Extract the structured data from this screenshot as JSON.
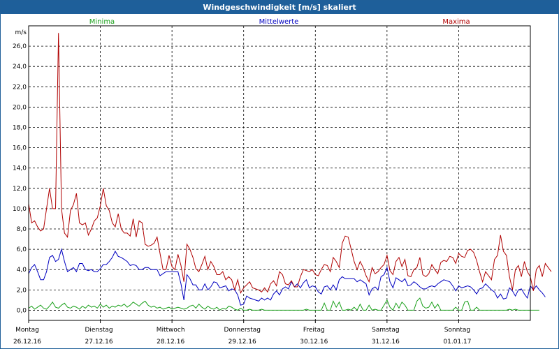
{
  "window": {
    "title": "Windgeschwindigkeit [m/s] skaliert"
  },
  "chart_data": {
    "type": "line",
    "title": "Windgeschwindigkeit [m/s] skaliert",
    "ylabel": "m/s",
    "ylim": [
      -1.0,
      28.0
    ],
    "xlim": [
      0,
      168
    ],
    "yticks": [
      "0,0",
      "2,0",
      "4,0",
      "6,0",
      "8,0",
      "10,0",
      "12,0",
      "14,0",
      "16,0",
      "18,0",
      "20,0",
      "22,0",
      "24,0",
      "26,0"
    ],
    "xtick_days": [
      "Montag",
      "Dienstag",
      "Mittwoch",
      "Donnerstag",
      "Freitag",
      "Samstag",
      "Sonntag"
    ],
    "xtick_dates": [
      "26.12.16",
      "27.12.16",
      "28.12.16",
      "29.12.16",
      "30.12.16",
      "31.12.16",
      "01.01.17"
    ],
    "grid": true,
    "legend": "top",
    "series": [
      {
        "name": "Minima",
        "color": "#1aa01a",
        "values": [
          0.2,
          0.4,
          0.1,
          0.3,
          0.5,
          0.2,
          0.1,
          0.4,
          0.8,
          0.3,
          0.2,
          0.5,
          0.7,
          0.3,
          0.2,
          0.4,
          0.3,
          0.1,
          0.4,
          0.2,
          0.5,
          0.3,
          0.4,
          0.2,
          0.6,
          0.3,
          0.5,
          0.2,
          0.4,
          0.3,
          0.5,
          0.4,
          0.6,
          0.3,
          0.5,
          0.8,
          0.6,
          0.4,
          0.7,
          0.9,
          0.5,
          0.3,
          0.4,
          0.2,
          0.3,
          0.1,
          0.2,
          0.3,
          0.1,
          0.2,
          0.3,
          0.2,
          0.1,
          0.2,
          0.4,
          0.5,
          0.2,
          0.6,
          0.3,
          0.1,
          0.4,
          0.2,
          0.1,
          0.3,
          0.0,
          0.2,
          0.1,
          0.4,
          0.3,
          0.1,
          0.0,
          0.2,
          0.0,
          0.0,
          0.1,
          0.0,
          0.0,
          0.0,
          0.1,
          0.0,
          0.0,
          0.0,
          0.0,
          0.0,
          0.0,
          0.0,
          0.0,
          0.0,
          0.0,
          0.0,
          0.0,
          0.0,
          0.0,
          0.1,
          0.0,
          0.0,
          0.0,
          0.0,
          0.0,
          0.7,
          0.0,
          0.0,
          0.0,
          0.0,
          0.2,
          0.0,
          0.0,
          0.1,
          0.0,
          0.3,
          0.0,
          0.0,
          0.0,
          0.0,
          0.5,
          0.0,
          0.1,
          0.0,
          0.0,
          0.0,
          0.0,
          0.2,
          0.0,
          0.0,
          0.0,
          0.0,
          0.5,
          0.0,
          0.0,
          0.0,
          0.0,
          0.0,
          0.2,
          0.0,
          0.0,
          0.0,
          0.0,
          0.0,
          0.0,
          0.0,
          0.0,
          0.0,
          0.0,
          0.3,
          0.0,
          0.0,
          0.0,
          0.0,
          0.0,
          0.0,
          0.0,
          0.0,
          0.0,
          0.0,
          0.0,
          0.0,
          0.0,
          0.0,
          0.0,
          0.0,
          0.0,
          0.1,
          0.0,
          0.0,
          0.0,
          0.0,
          0.0,
          0.0,
          0.0,
          0.0,
          0.0,
          0.0
        ],
        "overrides": [
          [
            102,
            0.9
          ],
          [
            103,
            0.3
          ],
          [
            104,
            0.8
          ],
          [
            111,
            0.6
          ],
          [
            119,
            0.5
          ],
          [
            120,
            1.0
          ],
          [
            121,
            0.3
          ],
          [
            123,
            0.7
          ],
          [
            124,
            0.2
          ],
          [
            125,
            0.8
          ],
          [
            130,
            0.9
          ],
          [
            131,
            1.2
          ],
          [
            132,
            0.4
          ],
          [
            133,
            0.2
          ],
          [
            134,
            0.3
          ],
          [
            135,
            0.8
          ],
          [
            136,
            0.2
          ],
          [
            137,
            0.6
          ],
          [
            146,
            0.8
          ],
          [
            147,
            0.9
          ],
          [
            150,
            0.3
          ],
          [
            163,
            0.1
          ]
        ]
      },
      {
        "name": "Mittelwerte",
        "color": "#0000c0",
        "values": [
          3.6,
          4.2,
          4.5,
          3.8,
          3.0,
          3.0,
          3.8,
          5.2,
          5.4,
          4.8,
          5.0,
          6.0,
          4.8,
          3.8,
          4.0,
          4.2,
          3.8,
          4.6,
          4.6,
          4.0,
          3.9,
          4.0,
          3.8,
          3.8,
          4.1,
          4.5,
          4.5,
          4.8,
          5.2,
          5.8,
          5.3,
          5.2,
          5.0,
          4.8,
          4.4,
          4.5,
          4.4,
          4.0,
          4.0,
          4.2,
          4.2,
          4.0,
          4.0,
          4.0,
          3.4,
          3.6,
          3.8,
          3.8,
          3.8,
          3.8,
          3.8,
          2.6,
          1.0,
          3.5,
          3.1,
          2.5,
          2.5,
          2.0,
          2.0,
          2.6,
          2.0,
          2.3,
          2.8,
          2.7,
          2.2,
          2.3,
          2.4,
          1.9,
          2.1,
          2.0,
          1.5,
          0.5,
          0.6,
          1.4,
          1.2,
          1.1,
          1.0,
          0.9,
          1.2,
          1.0,
          1.2,
          1.0,
          1.6,
          1.9,
          1.5,
          2.1,
          2.3,
          2.1,
          2.8,
          2.3,
          2.6,
          2.2,
          2.7,
          3.0,
          2.2,
          2.4,
          2.3,
          1.8,
          1.6,
          2.3,
          2.4,
          2.0,
          2.5,
          2.0,
          3.0,
          3.3,
          3.1,
          3.1,
          3.1,
          3.1,
          2.8,
          3.0,
          2.8,
          2.6,
          1.5,
          2.1,
          2.3,
          2.0,
          2.7,
          2.1,
          1.9,
          2.0,
          2.3,
          1.8,
          2.3,
          2.0,
          1.4,
          1.3,
          1.8,
          2.1,
          2.0,
          2.0,
          2.0,
          2.4,
          2.0,
          2.4,
          2.7,
          2.2,
          2.6,
          1.9,
          1.9,
          1.7,
          1.6,
          2.4,
          2.5,
          2.8,
          2.6,
          1.8,
          2.0,
          1.9,
          2.2,
          2.5,
          2.5,
          2.8,
          2.5,
          2.6,
          2.9,
          2.9,
          2.6,
          2.2,
          2.0,
          1.5,
          2.7,
          2.4,
          2.5,
          1.4,
          1.2,
          1.8,
          2.4,
          2.0,
          2.4,
          2.0,
          1.7,
          1.3
        ],
        "overrides": [
          [
            118,
            3.3
          ],
          [
            119,
            3.5
          ],
          [
            120,
            4.2
          ],
          [
            121,
            2.8
          ],
          [
            122,
            2.2
          ],
          [
            123,
            3.2
          ],
          [
            124,
            3.0
          ],
          [
            125,
            2.8
          ],
          [
            126,
            3.1
          ],
          [
            127,
            2.4
          ],
          [
            128,
            2.5
          ],
          [
            129,
            2.8
          ],
          [
            130,
            2.6
          ],
          [
            131,
            2.3
          ],
          [
            132,
            2.1
          ],
          [
            133,
            2.1
          ],
          [
            134,
            2.3
          ],
          [
            135,
            2.4
          ],
          [
            136,
            2.3
          ],
          [
            137,
            2.6
          ],
          [
            138,
            2.8
          ],
          [
            139,
            3.0
          ],
          [
            140,
            2.9
          ],
          [
            141,
            2.8
          ],
          [
            142,
            2.4
          ],
          [
            143,
            1.9
          ],
          [
            144,
            2.4
          ],
          [
            145,
            2.2
          ],
          [
            146,
            2.3
          ],
          [
            147,
            2.4
          ],
          [
            148,
            2.3
          ],
          [
            149,
            2.0
          ],
          [
            150,
            1.6
          ],
          [
            151,
            2.1
          ],
          [
            152,
            2.2
          ],
          [
            153,
            2.6
          ],
          [
            154,
            2.3
          ],
          [
            155,
            2.0
          ],
          [
            156,
            1.8
          ],
          [
            157,
            1.2
          ],
          [
            158,
            1.6
          ],
          [
            159,
            1.1
          ],
          [
            160,
            1.2
          ],
          [
            161,
            2.2
          ],
          [
            162,
            1.9
          ],
          [
            163,
            1.4
          ],
          [
            164,
            2.0
          ],
          [
            165,
            2.1
          ],
          [
            166,
            1.6
          ],
          [
            167,
            1.2
          ]
        ]
      },
      {
        "name": "Maxima",
        "color": "#b00000",
        "values": [
          10.5,
          8.6,
          8.8,
          8.2,
          7.8,
          8.0,
          10.0,
          12.0,
          10.0,
          10.0,
          27.3,
          10.0,
          7.6,
          7.2,
          9.8,
          10.4,
          11.5,
          8.6,
          8.4,
          8.6,
          7.4,
          8.0,
          8.8,
          9.1,
          10.3,
          12.0,
          10.3,
          9.8,
          8.6,
          8.2,
          9.5,
          8.0,
          7.6,
          7.6,
          7.3,
          9.0,
          7.2,
          8.8,
          8.6,
          6.5,
          6.3,
          6.4,
          6.6,
          7.2,
          5.6,
          4.0,
          4.0,
          5.4,
          4.3,
          4.0,
          5.5,
          4.4,
          2.8,
          6.5,
          6.0,
          5.2,
          4.1,
          3.8,
          4.5,
          5.3,
          4.0,
          4.8,
          4.3,
          3.5,
          3.5,
          3.8,
          3.0,
          3.3,
          3.0,
          2.0,
          3.0,
          1.7,
          2.2,
          2.5,
          2.8,
          2.2,
          2.1,
          2.0,
          1.8,
          2.2,
          1.8,
          2.6,
          2.9,
          2.4,
          3.8,
          3.5,
          2.6,
          2.5,
          2.9,
          2.3,
          2.3,
          3.3,
          4.0,
          3.9,
          3.8,
          4.0,
          3.5,
          3.4,
          4.0,
          4.5,
          4.4,
          3.8,
          5.2,
          4.8,
          4.2,
          6.6,
          7.3,
          7.2,
          6.0,
          4.8,
          4.0,
          4.8,
          4.2,
          3.4,
          2.8,
          4.2,
          3.6,
          3.8,
          3.6,
          4.3,
          3.2,
          3.8,
          4.0,
          3.7,
          4.1,
          3.3,
          2.9,
          2.7,
          3.4,
          3.8,
          3.1,
          3.0,
          3.1,
          3.0,
          3.3,
          3.9,
          3.7,
          3.6,
          4.1,
          5.3,
          3.7,
          4.2,
          4.8,
          5.2,
          4.4,
          3.9,
          3.4,
          3.7,
          4.0,
          4.6,
          4.7,
          5.2,
          5.2,
          5.7,
          5.9,
          6.0,
          5.7,
          4.7,
          3.4,
          2.8,
          3.9,
          3.4,
          3.0,
          5.5,
          5.4,
          7.4,
          5.8,
          5.2,
          3.3,
          1.9,
          4.0,
          4.4,
          3.3,
          4.6,
          4.2,
          3.8
        ],
        "overrides": [
          [
            118,
            4.2
          ],
          [
            119,
            4.5
          ],
          [
            120,
            5.4
          ],
          [
            121,
            3.9
          ],
          [
            122,
            3.5
          ],
          [
            123,
            4.8
          ],
          [
            124,
            5.2
          ],
          [
            125,
            4.3
          ],
          [
            126,
            5.0
          ],
          [
            127,
            3.4
          ],
          [
            128,
            3.3
          ],
          [
            129,
            4.0
          ],
          [
            130,
            4.2
          ],
          [
            131,
            5.2
          ],
          [
            132,
            3.5
          ],
          [
            133,
            3.3
          ],
          [
            134,
            3.6
          ],
          [
            135,
            4.5
          ],
          [
            136,
            4.0
          ],
          [
            137,
            3.6
          ],
          [
            138,
            4.7
          ],
          [
            139,
            4.9
          ],
          [
            140,
            4.8
          ],
          [
            141,
            5.3
          ],
          [
            142,
            5.2
          ],
          [
            143,
            4.6
          ],
          [
            144,
            5.6
          ],
          [
            145,
            5.3
          ],
          [
            146,
            5.2
          ],
          [
            147,
            5.9
          ],
          [
            148,
            6.0
          ],
          [
            149,
            5.7
          ],
          [
            150,
            4.9
          ],
          [
            151,
            3.8
          ],
          [
            152,
            2.8
          ],
          [
            153,
            3.8
          ],
          [
            154,
            3.4
          ],
          [
            155,
            3.0
          ],
          [
            156,
            5.0
          ],
          [
            157,
            5.4
          ],
          [
            158,
            7.4
          ],
          [
            159,
            5.8
          ],
          [
            160,
            5.4
          ],
          [
            161,
            3.3
          ],
          [
            162,
            2.0
          ],
          [
            163,
            4.0
          ],
          [
            164,
            4.4
          ],
          [
            165,
            3.3
          ],
          [
            166,
            4.8
          ],
          [
            167,
            3.8
          ]
        ]
      }
    ]
  }
}
